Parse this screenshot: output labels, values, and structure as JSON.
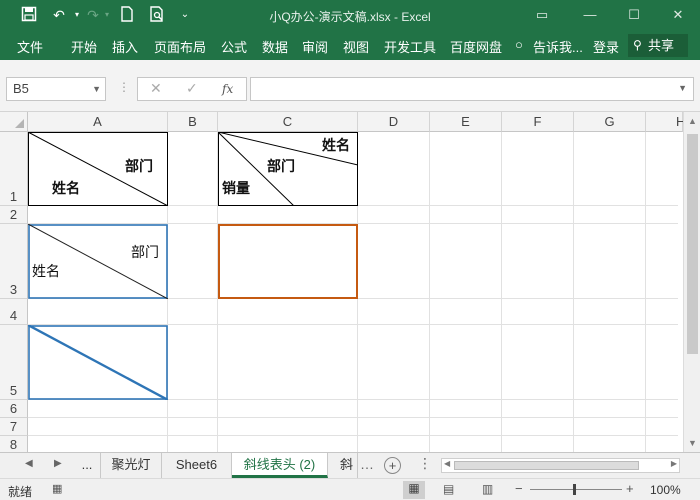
{
  "title": "小Q办公-演示文稿.xlsx - Excel",
  "ribbon_tabs": [
    "文件",
    "开始",
    "插入",
    "页面布局",
    "公式",
    "数据",
    "审阅",
    "视图",
    "开发工具",
    "百度网盘",
    "告诉我...",
    "登录"
  ],
  "share_label": "共享",
  "name_box": "B5",
  "columns": [
    "A",
    "B",
    "C",
    "D",
    "E",
    "F",
    "G",
    "H"
  ],
  "rows": [
    "1",
    "2",
    "3",
    "4",
    "5",
    "6",
    "7",
    "8"
  ],
  "cells": {
    "a1_top": "部门",
    "a1_bottom": "姓名",
    "c1_top": "姓名",
    "c1_mid": "部门",
    "c1_bottom": "销量",
    "a3_top": "部门",
    "a3_bottom": "姓名"
  },
  "sheet_tabs": [
    "...",
    "聚光灯",
    "Sheet6",
    "斜线表头 (2)",
    "斜"
  ],
  "active_sheet_index": 3,
  "status_text": "就绪",
  "zoom": "100%",
  "colors": {
    "excel_green": "#217346",
    "selected_border": "#c55a11",
    "diag_blue": "#2e75b6"
  }
}
